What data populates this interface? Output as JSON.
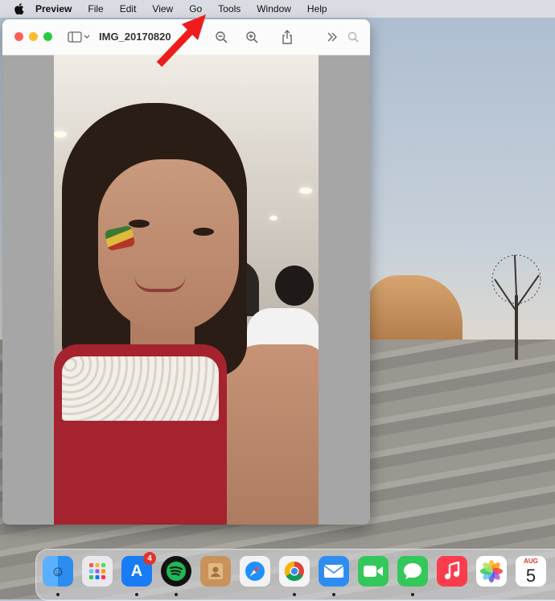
{
  "menubar": {
    "app_name": "Preview",
    "items": [
      "File",
      "Edit",
      "View",
      "Go",
      "Tools",
      "Window",
      "Help"
    ]
  },
  "window": {
    "title": "IMG_20170820"
  },
  "dock": {
    "apps": [
      {
        "name": "Finder",
        "icon": "finder-icon",
        "color": "#2d8cf0"
      },
      {
        "name": "Launchpad",
        "icon": "launchpad-icon",
        "color": "#e9e9ec"
      },
      {
        "name": "App Store",
        "icon": "app-store-icon",
        "color": "#1a7cf5",
        "badge": "4"
      },
      {
        "name": "Spotify",
        "icon": "spotify-icon",
        "color": "#1db954"
      },
      {
        "name": "Contacts",
        "icon": "contacts-icon",
        "color": "#c9925a"
      },
      {
        "name": "Safari",
        "icon": "safari-icon",
        "color": "#1e90ff"
      },
      {
        "name": "Chrome",
        "icon": "chrome-icon",
        "color": "#ffffff"
      },
      {
        "name": "Mail",
        "icon": "mail-icon",
        "color": "#2f8df2"
      },
      {
        "name": "FaceTime",
        "icon": "facetime-icon",
        "color": "#34c759"
      },
      {
        "name": "Messages",
        "icon": "messages-icon",
        "color": "#34c759"
      },
      {
        "name": "Music",
        "icon": "music-icon",
        "color": "#fa3c4c"
      },
      {
        "name": "Photos",
        "icon": "photos-icon",
        "color": "#ffffff"
      },
      {
        "name": "Calendar",
        "icon": "calendar-icon",
        "color": "#ffffff",
        "month": "AUG",
        "day": "5"
      }
    ]
  }
}
